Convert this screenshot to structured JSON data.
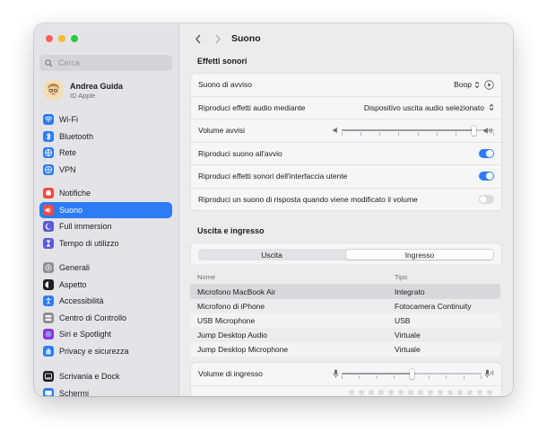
{
  "search": {
    "placeholder": "Cerca"
  },
  "user": {
    "name": "Andrea Guida",
    "subtitle": "ID Apple"
  },
  "sidebar": {
    "groups": [
      [
        {
          "label": "Wi-Fi",
          "icon": "wifi-icon",
          "color": "#2d7cf6"
        },
        {
          "label": "Bluetooth",
          "icon": "bluetooth-icon",
          "color": "#2d7cf6"
        },
        {
          "label": "Rete",
          "icon": "globe-icon",
          "color": "#2d7cf6"
        },
        {
          "label": "VPN",
          "icon": "vpn-icon",
          "color": "#2d7cf6"
        }
      ],
      [
        {
          "label": "Notifiche",
          "icon": "bell-icon",
          "color": "#ef4b44"
        },
        {
          "label": "Suono",
          "icon": "speaker-icon",
          "color": "#ef4b44",
          "active": true
        },
        {
          "label": "Full immersion",
          "icon": "moon-icon",
          "color": "#5b5bd6"
        },
        {
          "label": "Tempo di utilizzo",
          "icon": "hourglass-icon",
          "color": "#5b5bd6"
        }
      ],
      [
        {
          "label": "Generali",
          "icon": "gear-icon",
          "color": "#8e8e93"
        },
        {
          "label": "Aspetto",
          "icon": "appearance-icon",
          "color": "#1d1d1f"
        },
        {
          "label": "Accessibilità",
          "icon": "accessibility-icon",
          "color": "#2d7cf6"
        },
        {
          "label": "Centro di Controllo",
          "icon": "control-center-icon",
          "color": "#8e8e93"
        },
        {
          "label": "Siri e Spotlight",
          "icon": "siri-icon",
          "color": "#7a3ce0"
        },
        {
          "label": "Privacy e sicurezza",
          "icon": "hand-icon",
          "color": "#2d7cf6"
        }
      ],
      [
        {
          "label": "Scrivania e Dock",
          "icon": "dock-icon",
          "color": "#1d1d1f"
        },
        {
          "label": "Schermi",
          "icon": "display-icon",
          "color": "#2d7cf6"
        }
      ]
    ]
  },
  "header": {
    "title": "Suono"
  },
  "effects": {
    "heading": "Effetti sonori",
    "alert_sound_label": "Suono di avviso",
    "alert_sound_value": "Boop",
    "play_via_label": "Riproduci effetti audio mediante",
    "play_via_value": "Dispositivo uscita audio selezionato",
    "alert_volume_label": "Volume avvisi",
    "alert_volume_level": 0.87,
    "startup_label": "Riproduci suono all'avvio",
    "startup_on": true,
    "ui_sounds_label": "Riproduci effetti sonori dell'interfaccia utente",
    "ui_sounds_on": true,
    "feedback_label": "Riproduci un suono di risposta quando viene modificato il volume",
    "feedback_on": false
  },
  "io": {
    "heading": "Uscita e ingresso",
    "tabs": [
      "Uscita",
      "Ingresso"
    ],
    "selected_tab": "Ingresso",
    "columns": [
      "Nome",
      "Tipo"
    ],
    "devices": [
      {
        "name": "Microfono MacBook Air",
        "type": "Integrato",
        "selected": true
      },
      {
        "name": "Microfono di iPhone",
        "type": "Fotocamera Continuity"
      },
      {
        "name": "USB Microphone",
        "type": "USB"
      },
      {
        "name": "Jump Desktop Audio",
        "type": "Virtuale"
      },
      {
        "name": "Jump Desktop Microphone",
        "type": "Virtuale"
      }
    ],
    "input_volume_label": "Volume di ingresso",
    "input_volume_level": 0.5
  }
}
